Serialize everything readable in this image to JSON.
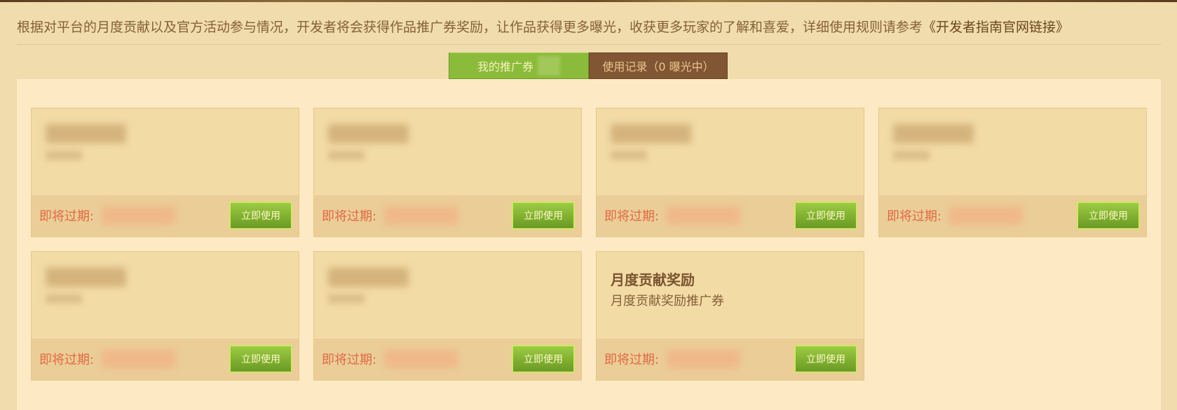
{
  "intro": {
    "text": "根据对平台的月度贡献以及官方活动参与情况，开发者将会获得作品推广券奖励，让作品获得更多曝光，收获更多玩家的了解和喜爱，详细使用规则请参考",
    "link": "《开发者指南官网链接》"
  },
  "tabs": {
    "coupons_label": "我的推广券",
    "records_label": "使用记录（0 曝光中）"
  },
  "cards": [
    {
      "title": "",
      "desc": "",
      "expire_label": "即将过期:",
      "use_label": "立即使用"
    },
    {
      "title": "",
      "desc": "",
      "expire_label": "即将过期:",
      "use_label": "立即使用"
    },
    {
      "title": "",
      "desc": "",
      "expire_label": "即将过期:",
      "use_label": "立即使用"
    },
    {
      "title": "",
      "desc": "",
      "expire_label": "即将过期:",
      "use_label": "立即使用"
    },
    {
      "title": "",
      "desc": "",
      "expire_label": "即将过期:",
      "use_label": "立即使用"
    },
    {
      "title": "",
      "desc": "",
      "expire_label": "即将过期:",
      "use_label": "立即使用"
    },
    {
      "title": "月度贡献奖励",
      "desc": "月度贡献奖励推广券",
      "expire_label": "即将过期:",
      "use_label": "立即使用"
    }
  ],
  "colors": {
    "page_bg": "#f0dcac",
    "panel_bg": "#fde9c3",
    "active_tab": "#8abb3a",
    "inactive_tab": "#815634",
    "expire_text": "#e06a45",
    "use_button": "#7fb02f"
  }
}
